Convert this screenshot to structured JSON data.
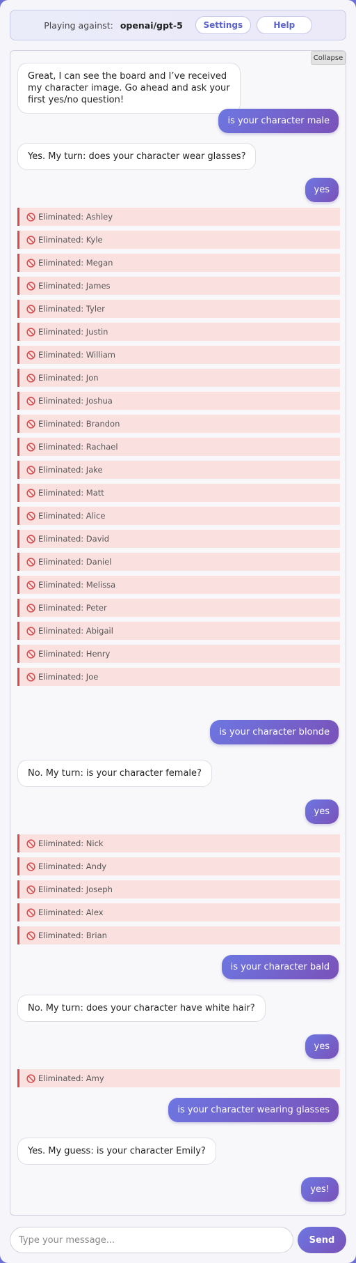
{
  "header": {
    "playing_label": "Playing against:",
    "model": "openai/gpt-5",
    "settings_label": "Settings",
    "help_label": "Help"
  },
  "chat": {
    "collapse_label": "Collapse",
    "messages": [
      {
        "text": "Great, I can see the board and I’ve received my character image. Go ahead and ask your first yes/no question!"
      },
      {
        "text": "is your character male"
      },
      {
        "text": "Yes. My turn: does your character wear glasses?"
      },
      {
        "text": "yes"
      },
      {
        "text": "Eliminated: Ashley"
      },
      {
        "text": "Eliminated: Kyle"
      },
      {
        "text": "Eliminated: Megan"
      },
      {
        "text": "Eliminated: James"
      },
      {
        "text": "Eliminated: Tyler"
      },
      {
        "text": "Eliminated: Justin"
      },
      {
        "text": "Eliminated: William"
      },
      {
        "text": "Eliminated: Jon"
      },
      {
        "text": "Eliminated: Joshua"
      },
      {
        "text": "Eliminated: Brandon"
      },
      {
        "text": "Eliminated: Rachael"
      },
      {
        "text": "Eliminated: Jake"
      },
      {
        "text": "Eliminated: Matt"
      },
      {
        "text": "Eliminated: Alice"
      },
      {
        "text": "Eliminated: David"
      },
      {
        "text": "Eliminated: Daniel"
      },
      {
        "text": "Eliminated: Melissa"
      },
      {
        "text": "Eliminated: Peter"
      },
      {
        "text": "Eliminated: Abigail"
      },
      {
        "text": "Eliminated: Henry"
      },
      {
        "text": "Eliminated: Joe"
      },
      {
        "text": "is your character blonde"
      },
      {
        "text": "No. My turn: is your character female?"
      },
      {
        "text": "yes"
      },
      {
        "text": "Eliminated: Nick"
      },
      {
        "text": "Eliminated: Andy"
      },
      {
        "text": "Eliminated: Joseph"
      },
      {
        "text": "Eliminated: Alex"
      },
      {
        "text": "Eliminated: Brian"
      },
      {
        "text": "is your character bald"
      },
      {
        "text": "No. My turn: does your character have white hair?"
      },
      {
        "text": "yes"
      },
      {
        "text": "Eliminated: Amy"
      },
      {
        "text": "is your character wearing glasses"
      },
      {
        "text": "Yes. My guess: is your character Emily?"
      },
      {
        "text": "yes!"
      }
    ]
  },
  "composer": {
    "placeholder": "Type your message...",
    "send_label": "Send"
  },
  "colors": {
    "accent_start": "#6d77e2",
    "accent_end": "#7a51b8",
    "eliminated_bg": "#fbe0e0",
    "eliminated_border": "#d64b4b"
  }
}
